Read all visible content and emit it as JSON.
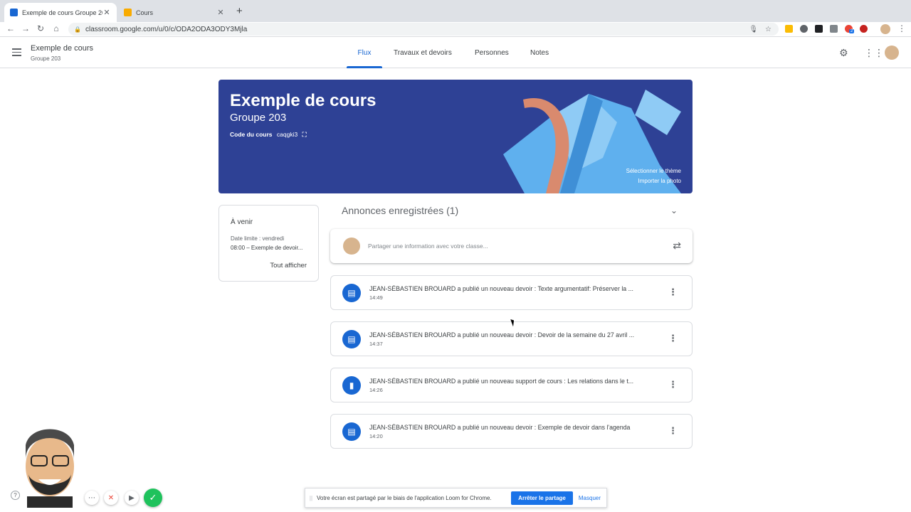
{
  "browser": {
    "tabs": [
      {
        "title": "Exemple de cours Groupe 203",
        "active": true,
        "favicon_color": "#1967d2"
      },
      {
        "title": "Cours",
        "active": false,
        "favicon_color": "#f9ab00"
      }
    ],
    "url": "classroom.google.com/u/0/c/ODA2ODA3ODY3Mjla",
    "extension_badge": "2"
  },
  "header": {
    "course_title": "Exemple de cours",
    "course_subtitle": "Groupe 203",
    "tabs": [
      {
        "label": "Flux",
        "active": true
      },
      {
        "label": "Travaux et devoirs",
        "active": false
      },
      {
        "label": "Personnes",
        "active": false
      },
      {
        "label": "Notes",
        "active": false
      }
    ]
  },
  "banner": {
    "title": "Exemple de cours",
    "subtitle": "Groupe 203",
    "code_label": "Code du cours",
    "code_value": "caqgki3",
    "select_theme": "Sélectionner le thème",
    "import_photo": "Importer la photo",
    "background_color": "#2e4195"
  },
  "upcoming": {
    "heading": "À venir",
    "due_label": "Date limite : vendredi",
    "item": "08:00 – Exemple de devoir...",
    "view_all": "Tout afficher"
  },
  "stream": {
    "saved_label": "Annonces enregistrées (1)",
    "share_placeholder": "Partager une information avec votre classe...",
    "posts": [
      {
        "text": "JEAN-SÉBASTIEN BROUARD a publié un nouveau devoir : Texte argumentatif: Préserver la ...",
        "time": "14:49",
        "icon": "assignment-icon"
      },
      {
        "text": "JEAN-SÉBASTIEN BROUARD a publié un nouveau devoir : Devoir de la semaine du 27 avril ...",
        "time": "14:37",
        "icon": "assignment-icon"
      },
      {
        "text": "JEAN-SÉBASTIEN BROUARD a publié un nouveau support de cours : Les relations dans le t...",
        "time": "14:26",
        "icon": "material-icon"
      },
      {
        "text": "JEAN-SÉBASTIEN BROUARD a publié un nouveau devoir : Exemple de devoir dans l'agenda",
        "time": "14:20",
        "icon": "assignment-icon"
      }
    ]
  },
  "loom": {
    "message": "Votre écran est partagé par le biais de l'application Loom for Chrome.",
    "stop_label": "Arrêter le partage",
    "hide_label": "Masquer"
  },
  "colors": {
    "accent": "#1967d2",
    "loom_ok": "#1ec25c"
  }
}
